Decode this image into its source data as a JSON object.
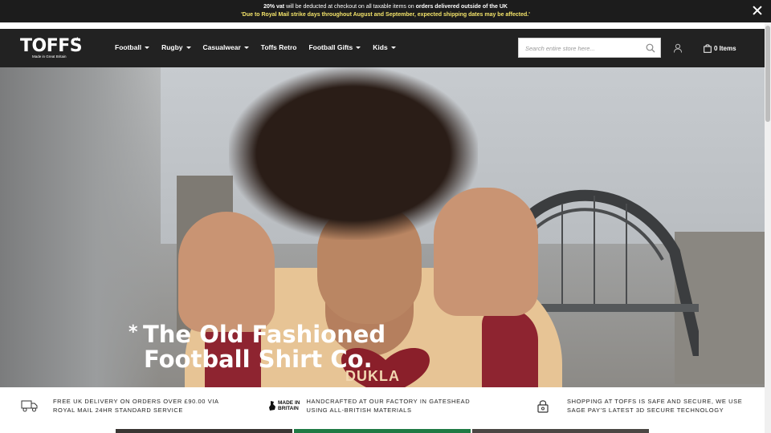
{
  "announcement": {
    "line1_bold_a": "20% vat",
    "line1_text_a": " will be deducted at checkout on all taxable items on ",
    "line1_bold_b": "orders delivered outside of the UK",
    "line2": "'Due to Royal Mail strike days throughout August and September, expected shipping dates may be affected.'"
  },
  "header": {
    "logo_word": "TOFFS",
    "logo_star": "*",
    "logo_tag": "Made in Great Britain",
    "nav": [
      {
        "label": "Football",
        "dropdown": true
      },
      {
        "label": "Rugby",
        "dropdown": true
      },
      {
        "label": "Casualwear",
        "dropdown": true
      },
      {
        "label": "Toffs Retro",
        "dropdown": false
      },
      {
        "label": "Football Gifts",
        "dropdown": true
      },
      {
        "label": "Kids",
        "dropdown": true
      }
    ],
    "search_placeholder": "Search entire store here...",
    "cart_label": "0 Items"
  },
  "hero": {
    "asterisk": "*",
    "headline_line1": "The Old Fashioned",
    "headline_line2": "Football Shirt Co.",
    "shirt_text": "DUKLA"
  },
  "usp": [
    {
      "icon": "delivery-truck-icon",
      "line1": "FREE UK DELIVERY ON ORDERS OVER £90.00 VIA",
      "line2": "ROYAL MAIL 24HR STANDARD SERVICE"
    },
    {
      "icon": "made-in-britain-icon",
      "badge_line1": "MADE IN",
      "badge_line2": "BRITAIN",
      "line1": "HANDCRAFTED AT OUR FACTORY IN GATESHEAD",
      "line2": "USING ALL-BRITISH MATERIALS"
    },
    {
      "icon": "padlock-icon",
      "line1": "SHOPPING AT TOFFS IS SAFE AND SECURE, WE USE",
      "line2": "SAGE PAY'S LATEST 3D SECURE TECHNOLOGY"
    }
  ],
  "colors": {
    "header_bg": "#222222",
    "announce_bg": "#1c1c1c",
    "announce_highlight": "#f3e36a"
  }
}
